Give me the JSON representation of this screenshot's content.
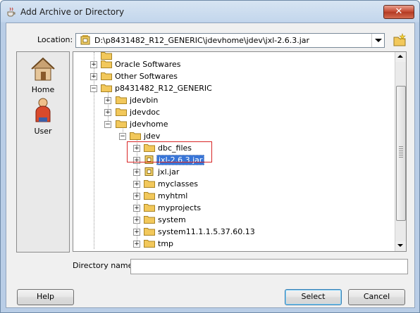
{
  "window": {
    "title": "Add Archive or Directory",
    "close_glyph": "✕"
  },
  "location": {
    "label": "Location:",
    "value": "D:\\p8431482_R12_GENERIC\\jdevhome\\jdev\\jxl-2.6.3.jar"
  },
  "places": [
    {
      "label": "Home",
      "icon": "home-icon"
    },
    {
      "label": "User",
      "icon": "user-icon"
    }
  ],
  "tree": {
    "items": [
      {
        "label": "Oracle Softwares",
        "type": "folder"
      },
      {
        "label": "Other Softwares",
        "type": "folder"
      },
      {
        "label": "p8431482_R12_GENERIC",
        "type": "folder"
      },
      {
        "label": "jdevbin",
        "type": "folder"
      },
      {
        "label": "jdevdoc",
        "type": "folder"
      },
      {
        "label": "jdevhome",
        "type": "folder"
      },
      {
        "label": "jdev",
        "type": "folder"
      },
      {
        "label": "dbc_files",
        "type": "folder"
      },
      {
        "label": "jxl-2.6.3.jar",
        "type": "jar",
        "selected": true
      },
      {
        "label": "jxl.jar",
        "type": "jar"
      },
      {
        "label": "myclasses",
        "type": "folder"
      },
      {
        "label": "myhtml",
        "type": "folder"
      },
      {
        "label": "myprojects",
        "type": "folder"
      },
      {
        "label": "system",
        "type": "folder"
      },
      {
        "label": "system11.1.1.5.37.60.13",
        "type": "folder"
      },
      {
        "label": "tmp",
        "type": "folder"
      }
    ]
  },
  "directory_name": {
    "label": "Directory name:",
    "value": ""
  },
  "buttons": {
    "help": "Help",
    "select": "Select",
    "cancel": "Cancel"
  },
  "colors": {
    "selection": "#3875d7",
    "highlight_box": "#d82525",
    "folder": "#f2c85b"
  }
}
